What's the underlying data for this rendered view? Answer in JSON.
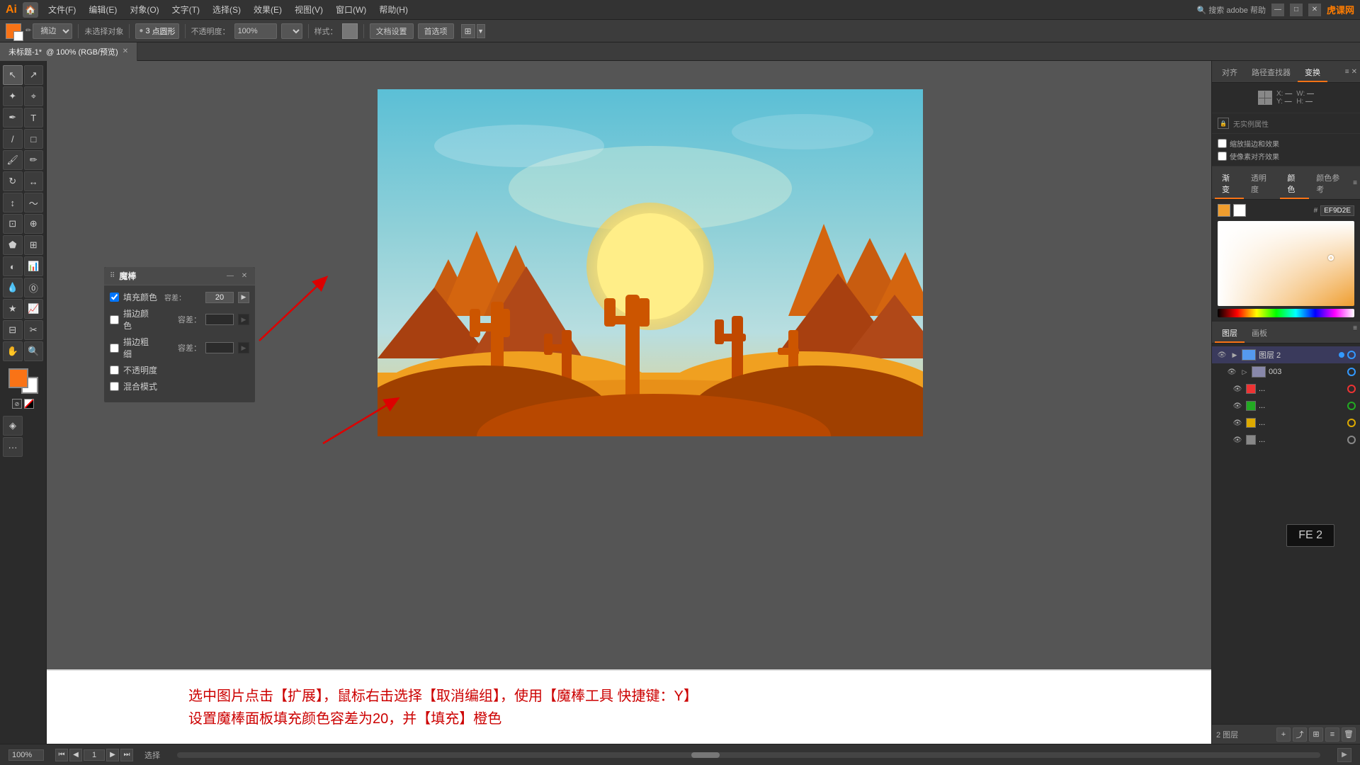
{
  "app": {
    "title": "Adobe Illustrator",
    "logo": "Ai",
    "watermark": "虎课网"
  },
  "menubar": {
    "items": [
      "文件(F)",
      "编辑(E)",
      "对象(O)",
      "文字(T)",
      "选择(S)",
      "效果(E)",
      "视图(V)",
      "窗口(W)",
      "帮助(H)"
    ]
  },
  "toolbar": {
    "no_selection": "未选择对象",
    "stroke_label": "描边：",
    "brush_label": "画笔：",
    "brush_value": "摘边",
    "point_count": "3",
    "shape_label": "点圆形",
    "opacity_label": "不透明度：",
    "opacity_value": "100%",
    "style_label": "样式：",
    "doc_settings": "文档设置",
    "first_item": "首选项"
  },
  "tab": {
    "name": "未标题-1*",
    "detail": "@ 100% (RGB/预览)"
  },
  "magic_wand_panel": {
    "title": "魔棒",
    "fill_color_label": "填充颜色",
    "fill_color_checked": true,
    "tolerance_label": "容差：",
    "tolerance_value": "20",
    "stroke_color_label": "描边颜色",
    "stroke_color_checked": false,
    "stroke_tolerance_label": "容差：",
    "stroke_tolerance_value": "",
    "stroke_width_label": "描边粗细",
    "stroke_width_checked": false,
    "stroke_width_tolerance_label": "容差：",
    "stroke_width_tolerance_value": "",
    "opacity_label": "不透明度",
    "opacity_checked": false,
    "blend_mode_label": "混合模式",
    "blend_mode_checked": false
  },
  "right_panel": {
    "tabs": [
      "对齐",
      "路径查找器",
      "变换"
    ],
    "active_tab": "变换",
    "transform": {
      "x_label": "X:",
      "x_value": "",
      "y_label": "Y:",
      "y_value": "",
      "w_label": "W:",
      "w_value": "",
      "h_label": "H:",
      "h_value": ""
    },
    "color_hex": "EF9D2E",
    "no_selection_msg": "无实例属性"
  },
  "layers_panel": {
    "tabs": [
      "图层",
      "画板"
    ],
    "active_tab": "图层",
    "footer_label": "2 图层",
    "layers": [
      {
        "name": "图层 2",
        "visible": true,
        "expanded": true,
        "active": true,
        "color": "#3399ff"
      },
      {
        "name": "003",
        "visible": true,
        "expanded": false,
        "active": false,
        "color": "#3399ff"
      },
      {
        "name": "...",
        "visible": true,
        "expanded": false,
        "active": false,
        "color": "#ee3333"
      },
      {
        "name": "...",
        "visible": true,
        "expanded": false,
        "active": false,
        "color": "#22aa22"
      },
      {
        "name": "...",
        "visible": true,
        "expanded": false,
        "active": false,
        "color": "#ddaa00"
      },
      {
        "name": "...",
        "visible": true,
        "expanded": false,
        "active": false,
        "color": "#888888"
      }
    ]
  },
  "instruction": {
    "line1": "选中图片点击【扩展】，鼠标右击选择【取消编组】，使用【魔棒工具 快捷键：Y】",
    "line2": "设置魔棒面板填充颜色容差为20，并【填充】橙色"
  },
  "status_bar": {
    "zoom": "100%",
    "page": "1",
    "action_label": "选择"
  },
  "fe2_badge": "FE 2"
}
